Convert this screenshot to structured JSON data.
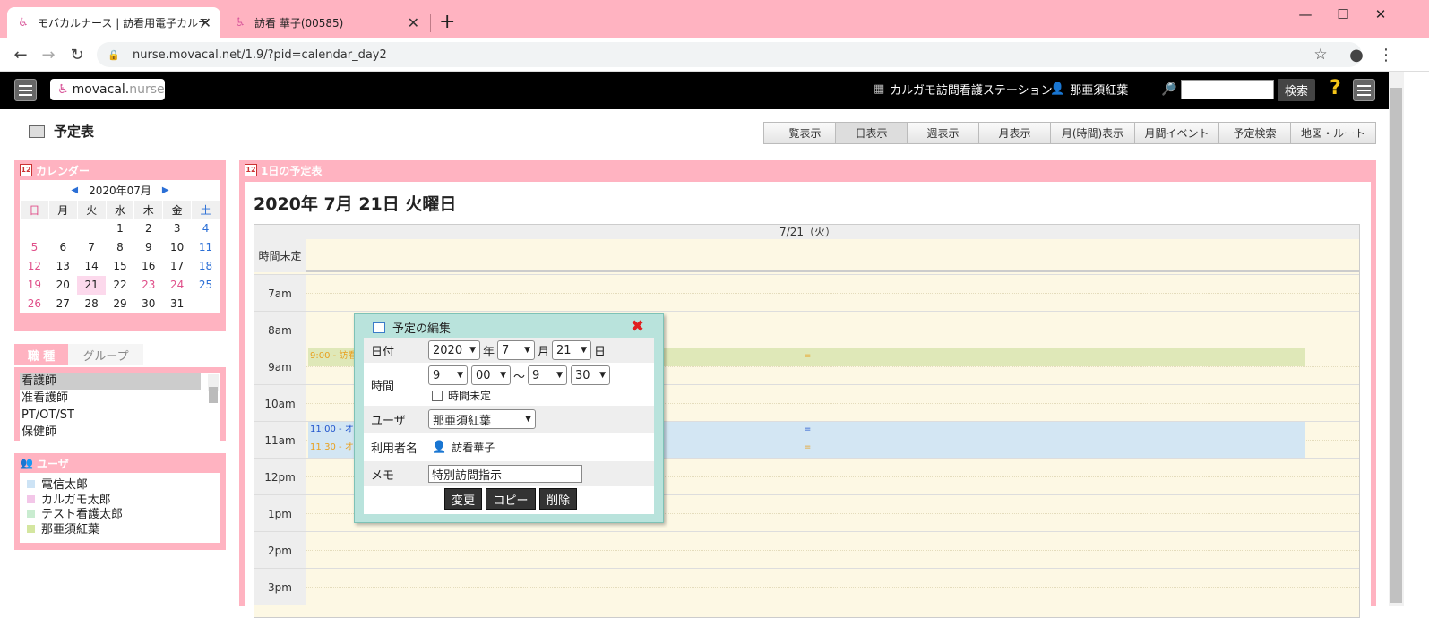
{
  "browser": {
    "tabs": [
      {
        "title": "モバカルナース | 訪看用電子カルテ",
        "active": true
      },
      {
        "title": "訪看 華子(00585)",
        "active": false
      }
    ],
    "new_tab": "+",
    "url": "nurse.movacal.net/1.9/?pid=calendar_day2",
    "window_controls": {
      "minimize": "—",
      "maximize": "☐",
      "close": "✕"
    }
  },
  "header": {
    "logo_main": "movacal.",
    "logo_sub": "nurse",
    "station": "カルガモ訪問看護ステーション",
    "user": "那亜須紅葉",
    "search_button": "検索",
    "help": "?"
  },
  "page": {
    "title": "予定表",
    "view_tabs": [
      "一覧表示",
      "日表示",
      "週表示",
      "月表示",
      "月(時間)表示",
      "月間イベント",
      "予定検索",
      "地図・ルート"
    ],
    "selected_view": "日表示"
  },
  "calendar": {
    "heading": "カレンダー",
    "month": "2020年07月",
    "weekdays": [
      "日",
      "月",
      "火",
      "水",
      "木",
      "金",
      "土"
    ],
    "weeks": [
      [
        "",
        "",
        "",
        "1",
        "2",
        "3",
        "4"
      ],
      [
        "5",
        "6",
        "7",
        "8",
        "9",
        "10",
        "11"
      ],
      [
        "12",
        "13",
        "14",
        "15",
        "16",
        "17",
        "18"
      ],
      [
        "19",
        "20",
        "21",
        "22",
        "23",
        "24",
        "25"
      ],
      [
        "26",
        "27",
        "28",
        "29",
        "30",
        "31",
        ""
      ]
    ],
    "today": "21",
    "holidays": [
      "23",
      "24"
    ]
  },
  "filters": {
    "tabs": [
      "職 種",
      "グループ"
    ],
    "jobs": [
      "看護師",
      "准看護師",
      "PT/OT/ST",
      "保健師"
    ],
    "selected_job": "看護師"
  },
  "users": {
    "heading": "ユーザ",
    "items": [
      {
        "name": "電信太郎",
        "color": "#cde3f5"
      },
      {
        "name": "カルガモ太郎",
        "color": "#f3c6e8"
      },
      {
        "name": "テスト看護太郎",
        "color": "#c9ecd0"
      },
      {
        "name": "那亜須紅葉",
        "color": "#d4e6a0"
      }
    ]
  },
  "schedule": {
    "heading": "1日の予定表",
    "date_title": "2020年 7月 21日 火曜日",
    "column": "7/21（火）",
    "undecided": "時間未定",
    "hours": [
      "7am",
      "8am",
      "9am",
      "10am",
      "11am",
      "12pm",
      "1pm",
      "2pm",
      "3pm"
    ],
    "events": [
      {
        "label": "9:00 - 訪看",
        "color": "#dfe8b8",
        "text_color": "#e8a020"
      },
      {
        "label": "11:00 - オ",
        "color": "#d3e6f3",
        "text_color": "#2255cc"
      },
      {
        "label": "11:30 - オ",
        "color": "#d3e6f3",
        "text_color": "#e8a020"
      }
    ]
  },
  "dialog": {
    "title": "予定の編集",
    "date_label": "日付",
    "year": "2020",
    "year_unit": "年",
    "month": "7",
    "month_unit": "月",
    "day": "21",
    "day_unit": "日",
    "time_label": "時間",
    "start_hour": "9",
    "start_min": "00",
    "tilde": "～",
    "end_hour": "9",
    "end_min": "30",
    "time_undecided": "時間未定",
    "user_label": "ユーザ",
    "user_value": "那亜須紅葉",
    "patient_label": "利用者名",
    "patient_value": "訪看華子",
    "memo_label": "メモ",
    "memo_value": "特別訪問指示",
    "btn_change": "変更",
    "btn_copy": "コピー",
    "btn_delete": "削除"
  }
}
